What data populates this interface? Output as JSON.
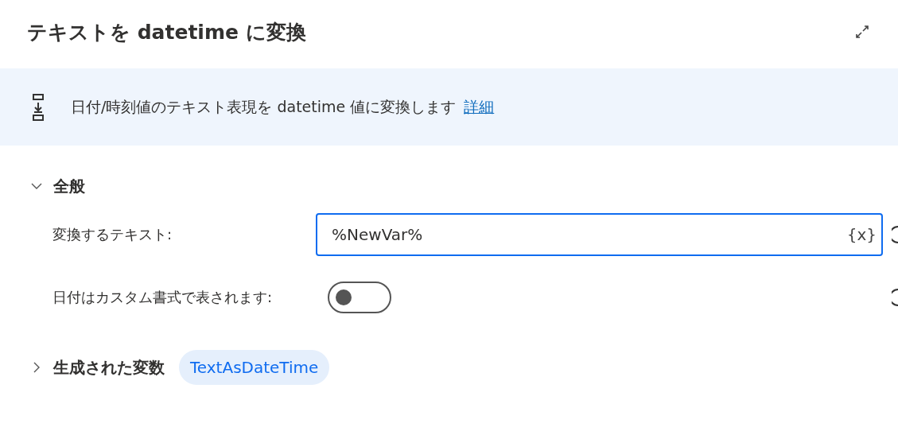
{
  "title": "テキストを datetime に変換",
  "description": {
    "text": "日付/時刻値のテキスト表現を datetime 値に変換します",
    "link": "詳細"
  },
  "sections": [
    {
      "kind": "parameters",
      "label": "全般",
      "expanded": true,
      "fields": [
        {
          "kind": "text",
          "label": "変換するテキスト:",
          "value": "%NewVar%",
          "variable_button": "{x}"
        },
        {
          "kind": "toggle",
          "label": "日付はカスタム書式で表されます:",
          "on": false
        }
      ]
    },
    {
      "kind": "variables",
      "label": "生成された変数",
      "expanded": false,
      "variables": [
        "TextAsDateTime"
      ]
    }
  ]
}
